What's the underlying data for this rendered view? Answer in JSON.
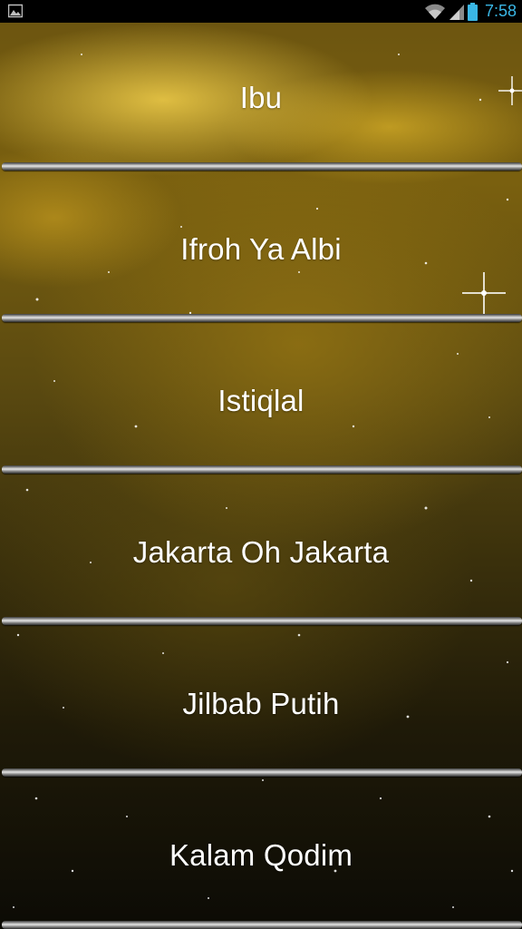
{
  "status_bar": {
    "time": "7:58",
    "icons": [
      "picture-icon",
      "wifi-icon",
      "signal-icon",
      "battery-icon"
    ]
  },
  "songs": [
    {
      "title": "Ibu"
    },
    {
      "title": "Ifroh Ya Albi"
    },
    {
      "title": "Istiqlal"
    },
    {
      "title": "Jakarta Oh Jakarta"
    },
    {
      "title": "Jilbab Putih"
    },
    {
      "title": "Kalam Qodim"
    }
  ],
  "colors": {
    "status_time": "#3ab7e6",
    "title_text": "#ffffff",
    "background_accent": "#d4b23a"
  }
}
